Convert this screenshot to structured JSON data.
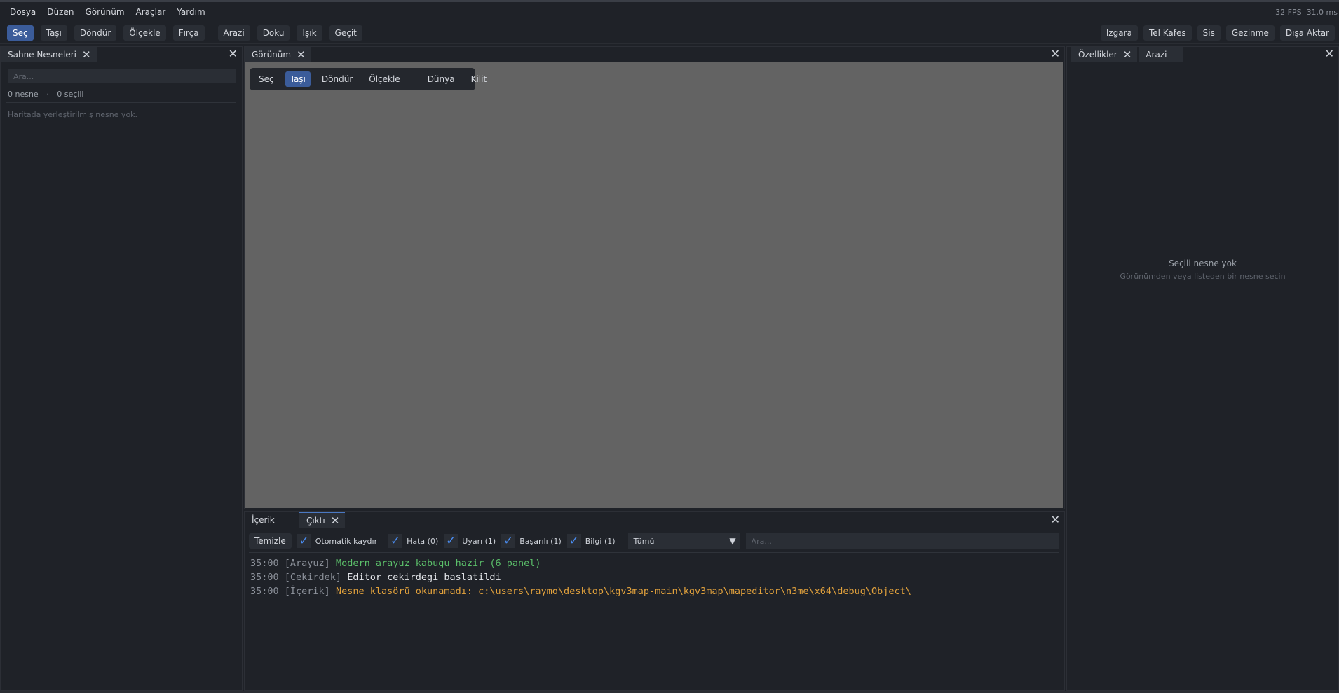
{
  "menu": [
    "Dosya",
    "Düzen",
    "Görünüm",
    "Araçlar",
    "Yardım"
  ],
  "perf": {
    "fps": "32 FPS",
    "ms": "31.0 ms"
  },
  "toolbar": {
    "left": [
      {
        "label": "Seç",
        "active": true
      },
      {
        "label": "Taşı"
      },
      {
        "label": "Döndür"
      },
      {
        "label": "Ölçekle"
      },
      {
        "label": "Fırça"
      }
    ],
    "left2": [
      {
        "label": "Arazi"
      },
      {
        "label": "Doku"
      },
      {
        "label": "Işık"
      },
      {
        "label": "Geçit"
      }
    ],
    "right": [
      "Izgara",
      "Tel Kafes",
      "Sis",
      "Gezinme",
      "Dışa Aktar"
    ]
  },
  "scene": {
    "tab": "Sahne Nesneleri",
    "search_placeholder": "Ara...",
    "count": "0 nesne",
    "sep": "·",
    "selected": "0 seçili",
    "empty": "Haritada yerleştirilmiş nesne yok."
  },
  "viewport": {
    "tab": "Görünüm",
    "tools": [
      {
        "label": "Seç"
      },
      {
        "label": "Taşı",
        "active": true
      },
      {
        "label": "Döndür"
      },
      {
        "label": "Ölçekle"
      },
      {
        "label": "Dünya"
      },
      {
        "label": "Kilit"
      }
    ]
  },
  "properties": {
    "tabs": [
      "Özellikler",
      "Arazi"
    ],
    "empty_title": "Seçili nesne yok",
    "empty_hint": "Görünümden veya listeden bir nesne seçin"
  },
  "output": {
    "tabs": [
      "İçerik",
      "Çıktı"
    ],
    "clear": "Temizle",
    "autoscroll": "Otomatik kaydır",
    "filters": [
      "Hata (0)",
      "Uyarı (1)",
      "Başarılı (1)",
      "Bilgi (1)"
    ],
    "level_select": "Tümü",
    "search_placeholder": "Ara...",
    "logs": [
      {
        "time": "35:00",
        "source": "[Arayuz]",
        "message": "Modern arayuz kabugu hazir (6 panel)",
        "color": "green"
      },
      {
        "time": "35:00",
        "source": "[Cekirdek]",
        "message": "Editor cekirdegi baslatildi",
        "color": "white"
      },
      {
        "time": "35:00",
        "source": "[İçerik]",
        "message": "Nesne klasörü okunamadı: c:\\users\\raymo\\desktop\\kgv3map-main\\kgv3map\\mapeditor\\n3me\\x64\\debug\\Object\\",
        "color": "orange"
      }
    ]
  },
  "colors": {
    "accent": "#3b5c9a",
    "viewport": "#636363",
    "success": "#5bbf6a",
    "warning": "#e1a13c"
  },
  "icons": {
    "close": "close-icon",
    "check": "check-icon",
    "dropdown": "caret-down-icon"
  }
}
